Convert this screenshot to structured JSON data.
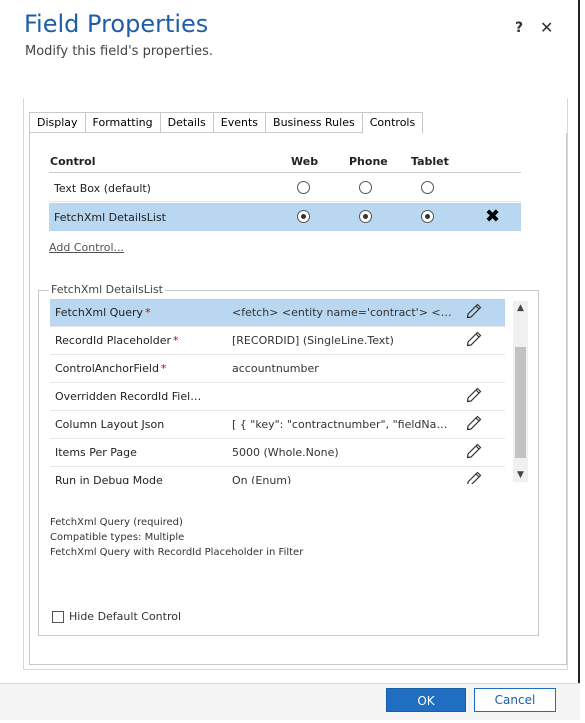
{
  "header": {
    "title": "Field Properties",
    "subtitle": "Modify this field's properties.",
    "help_icon": "?",
    "close_icon": "✕"
  },
  "tabs": [
    {
      "label": "Display"
    },
    {
      "label": "Formatting"
    },
    {
      "label": "Details"
    },
    {
      "label": "Events"
    },
    {
      "label": "Business Rules"
    },
    {
      "label": "Controls",
      "active": true
    }
  ],
  "controls": {
    "headers": {
      "control": "Control",
      "web": "Web",
      "phone": "Phone",
      "tablet": "Tablet"
    },
    "rows": [
      {
        "name": "Text Box (default)",
        "web": false,
        "phone": false,
        "tablet": false
      },
      {
        "name": "FetchXml DetailsList",
        "web": true,
        "phone": true,
        "tablet": true,
        "selected": true,
        "remove_icon": "✖"
      }
    ],
    "add_control": "Add Control..."
  },
  "properties": {
    "legend": "FetchXml DetailsList",
    "rows": [
      {
        "name": "FetchXml Query",
        "required": true,
        "value": "<fetch> <entity name='contract'> <att...",
        "editable": true,
        "selected": true
      },
      {
        "name": "RecordId Placeholder",
        "required": true,
        "value": "[RECORDID] (SingleLine.Text)",
        "editable": true
      },
      {
        "name": "ControlAnchorField",
        "required": true,
        "value": "accountnumber",
        "editable": false
      },
      {
        "name": "Overridden RecordId Field Na...",
        "required": false,
        "value": "",
        "editable": true
      },
      {
        "name": "Column Layout Json",
        "required": false,
        "value": "[ { \"key\": \"contractnumber\", \"fieldName\"...",
        "editable": true
      },
      {
        "name": "Items Per Page",
        "required": false,
        "value": "5000 (Whole.None)",
        "editable": true
      },
      {
        "name": "Run in Debug Mode",
        "required": false,
        "value": "On (Enum)",
        "editable": true
      }
    ],
    "required_mark": "*"
  },
  "info": {
    "line1": "FetchXml Query (required)",
    "line2": "Compatible types: Multiple",
    "line3": "FetchXml Query with RecordId Placeholder in Filter"
  },
  "hide_default": {
    "label": "Hide Default Control",
    "checked": false
  },
  "footer": {
    "ok": "OK",
    "cancel": "Cancel"
  },
  "colors": {
    "accent": "#1f6ec1",
    "title": "#1f5ea8",
    "selection": "#b9d7f1",
    "required": "#c00000"
  }
}
